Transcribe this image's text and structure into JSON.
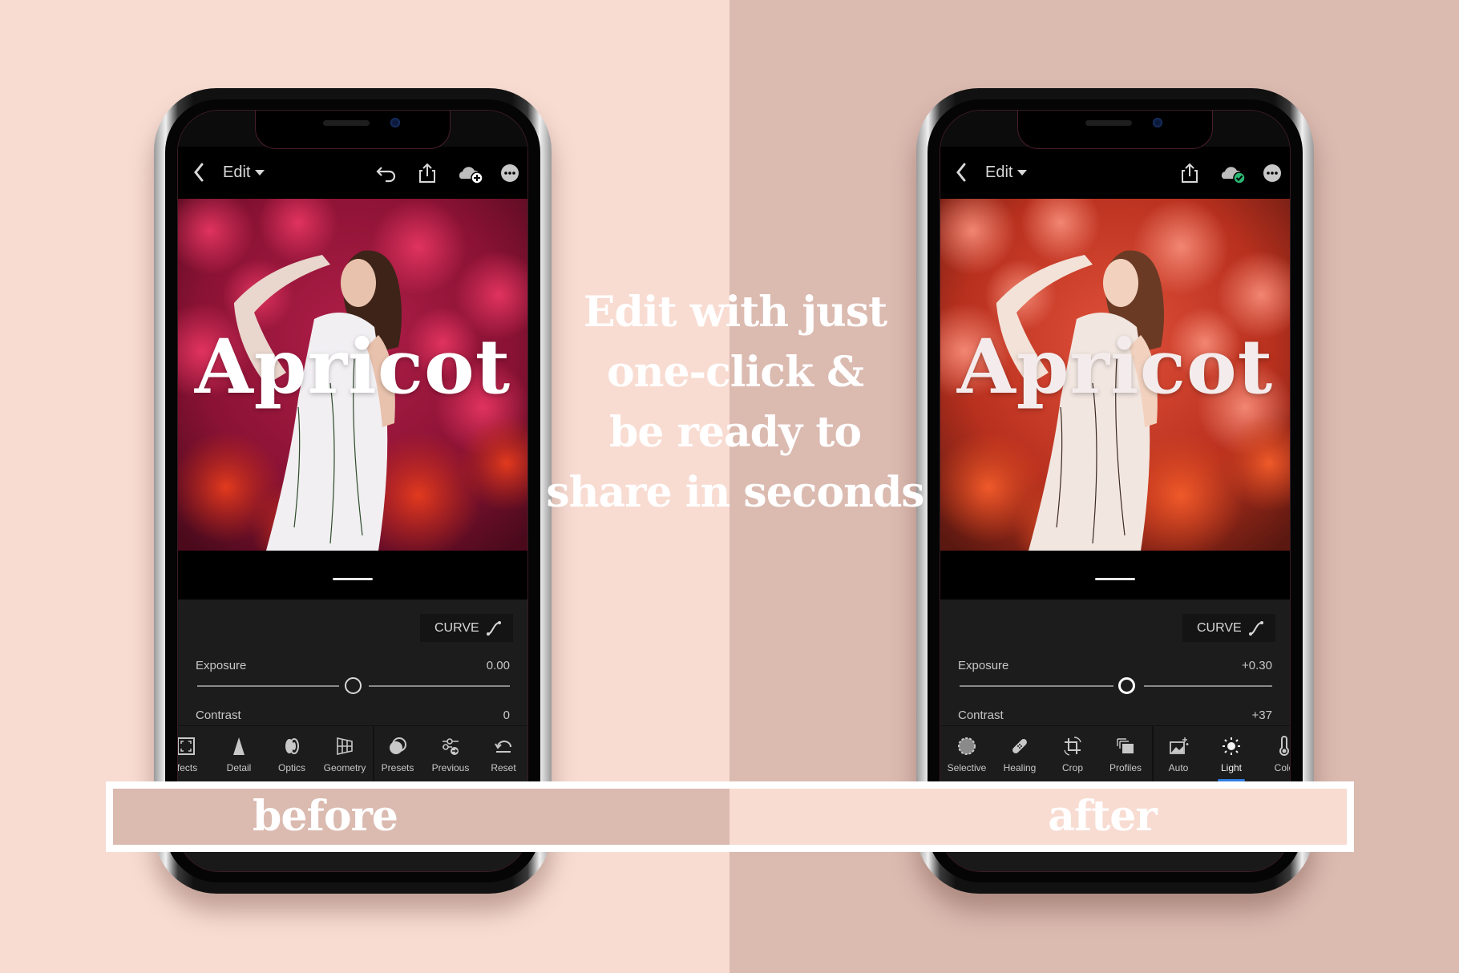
{
  "headline": {
    "lines": [
      "Edit with just",
      "one-click &",
      "be ready to",
      "share in seconds"
    ]
  },
  "banner": {
    "before_label": "before",
    "after_label": "after"
  },
  "colors": {
    "bg_light": "#f8dcd2",
    "bg_dark": "#dbbab0",
    "active_tab_underline": "#2f7be0",
    "cloud_synced_badge": "#2bb673"
  },
  "phones": {
    "before": {
      "nav": {
        "title": "Edit",
        "icons": [
          "back-icon",
          "undo-icon",
          "share-icon",
          "cloud-add-icon",
          "more-icon"
        ]
      },
      "photo_title": "Apricot",
      "curve_label": "CURVE",
      "exposure": {
        "label": "Exposure",
        "value": "0.00",
        "position": 0.0
      },
      "contrast": {
        "label": "Contrast",
        "value": "0"
      },
      "tools": [
        {
          "label": "ffects",
          "icon": "effects-icon"
        },
        {
          "label": "Detail",
          "icon": "detail-icon"
        },
        {
          "label": "Optics",
          "icon": "optics-icon"
        },
        {
          "label": "Geometry",
          "icon": "geometry-icon"
        },
        {
          "label": "Presets",
          "icon": "presets-icon"
        },
        {
          "label": "Previous",
          "icon": "previous-icon"
        },
        {
          "label": "Reset",
          "icon": "reset-icon"
        }
      ]
    },
    "after": {
      "nav": {
        "title": "Edit",
        "icons": [
          "back-icon",
          "share-icon",
          "cloud-synced-icon",
          "more-icon"
        ]
      },
      "photo_title": "Apricot",
      "curve_label": "CURVE",
      "exposure": {
        "label": "Exposure",
        "value": "+0.30",
        "position": 0.3
      },
      "contrast": {
        "label": "Contrast",
        "value": "+37"
      },
      "tools": [
        {
          "label": "Selective",
          "icon": "selective-icon"
        },
        {
          "label": "Healing",
          "icon": "healing-icon"
        },
        {
          "label": "Crop",
          "icon": "crop-icon"
        },
        {
          "label": "Profiles",
          "icon": "profiles-icon"
        },
        {
          "label": "Auto",
          "icon": "auto-icon"
        },
        {
          "label": "Light",
          "icon": "light-icon",
          "active": true
        },
        {
          "label": "Colo",
          "icon": "color-icon"
        }
      ]
    }
  }
}
